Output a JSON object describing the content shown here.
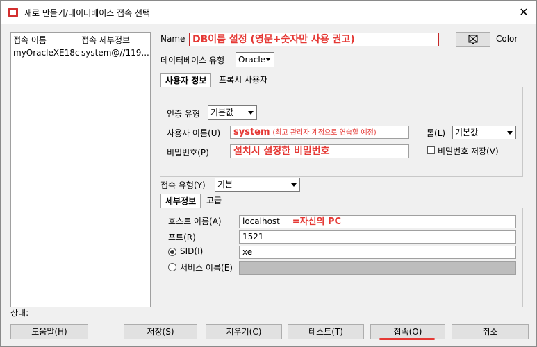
{
  "window": {
    "title": "새로 만들기/데이터베이스 접속 선택",
    "close": "✕"
  },
  "list": {
    "columns": [
      "접속 이름",
      "접속 세부정보"
    ],
    "rows": [
      {
        "name": "myOracleXE18c",
        "details": "system@//119...."
      }
    ]
  },
  "form": {
    "name_label": "Name",
    "name_value": "DB이름 설정 (영문+숫자만 사용 권고)",
    "color_label": "Color",
    "dbtype_label": "데이터베이스 유형",
    "dbtype_value": "Oracle",
    "tabs_top": [
      "사용자 정보",
      "프록시 사용자"
    ],
    "auth_label": "인증 유형",
    "auth_value": "기본값",
    "user_label": "사용자 이름(U)",
    "user_value": "system",
    "user_note": "(최고 관리자 계정으로 연습할 예정)",
    "role_label": "롤(L)",
    "role_value": "기본값",
    "pw_label": "비밀번호(P)",
    "pw_value": "설치시 설정한 비밀번호",
    "save_pw_label": "비밀번호 저장(V)",
    "conn_type_label": "접속 유형(Y)",
    "conn_type_value": "기본",
    "tabs_bottom": [
      "세부정보",
      "고급"
    ],
    "host_label": "호스트 이름(A)",
    "host_value": "localhost",
    "host_note": "=자신의 PC",
    "port_label": "포트(R)",
    "port_value": "1521",
    "sid_label": "SID(I)",
    "sid_value": "xe",
    "service_label": "서비스 이름(E)"
  },
  "status_label": "상태:",
  "buttons": {
    "help": "도움말(H)",
    "save": "저장(S)",
    "clear": "지우기(C)",
    "test": "테스트(T)",
    "connect": "접속(O)",
    "cancel": "취소"
  },
  "colors": {
    "annotation": "#e53935"
  }
}
